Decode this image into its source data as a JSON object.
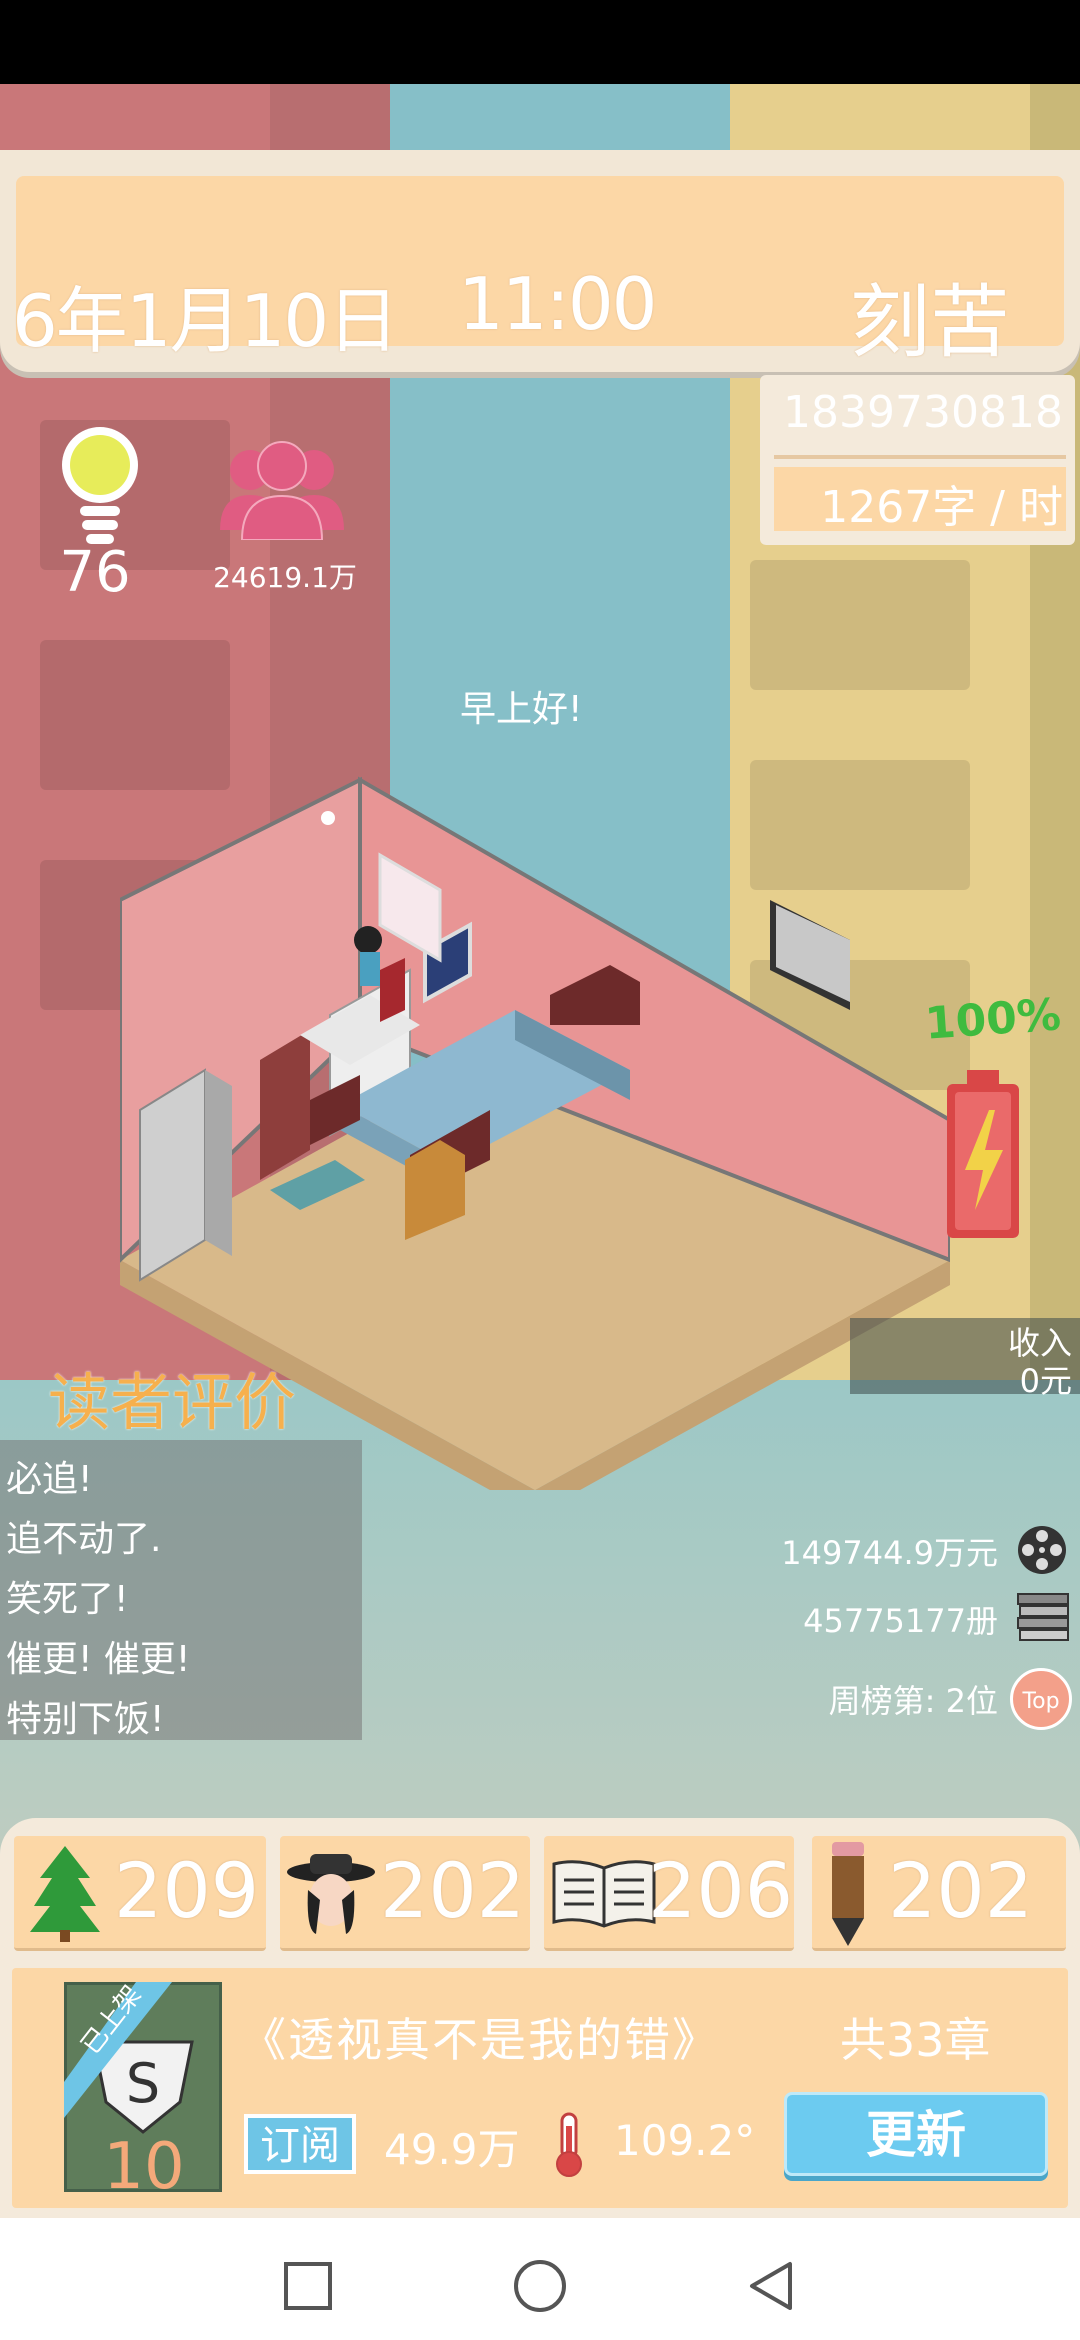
{
  "header": {
    "date": "6年1月10日",
    "time": "11:00",
    "mode": "刻苦"
  },
  "stats": {
    "money": "1839730818元",
    "word_rate": "1267字 / 时",
    "inspiration": "76",
    "fans": "24619.1万"
  },
  "greeting": "早上好!",
  "battery": {
    "percent_label": "100%",
    "level": 1.0
  },
  "income": {
    "label": "收入",
    "value": "0元"
  },
  "reviews": {
    "title": "读者评价",
    "items": [
      "必追!",
      "追不动了.",
      "笑死了!",
      "催更! 催更!",
      "特别下饭!"
    ]
  },
  "totals": {
    "sales": "149744.9万元",
    "books": "45775177册",
    "rank": "周榜第: 2位",
    "rank_badge": "Top"
  },
  "attributes": [
    {
      "icon": "tree-icon",
      "value": "209"
    },
    {
      "icon": "character-icon",
      "value": "202"
    },
    {
      "icon": "open-book-icon",
      "value": "206"
    },
    {
      "icon": "pencil-icon",
      "value": "202"
    }
  ],
  "book": {
    "ribbon": "已上架",
    "cover_number": "10",
    "title": "《透视真不是我的错》",
    "chapters": "共33章",
    "subscribe_label": "订阅",
    "subscribers": "49.9万",
    "heat": "109.2°",
    "update_label": "更新"
  },
  "colors": {
    "panel": "#fcd7a6",
    "panel_border": "#f4eadb",
    "accent_orange": "#f6b04d",
    "battery_green": "#3fbb3f",
    "fans_pink": "#e05c82"
  }
}
